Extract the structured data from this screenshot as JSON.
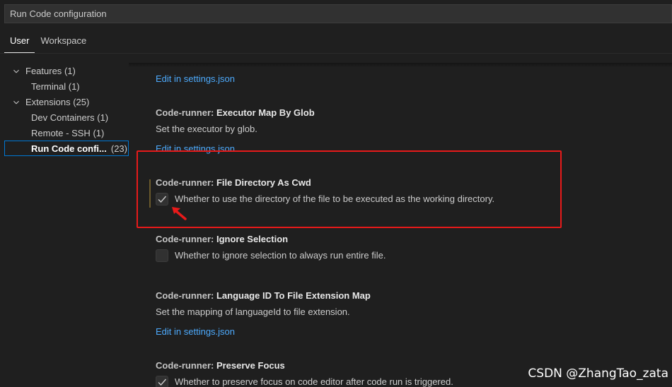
{
  "search": {
    "value": "Run Code configuration"
  },
  "tabs": [
    {
      "label": "User",
      "active": true
    },
    {
      "label": "Workspace",
      "active": false
    }
  ],
  "tree": [
    {
      "label": "Features",
      "count": "(1)"
    },
    {
      "label": "Terminal",
      "count": "(1)"
    },
    {
      "label": "Extensions",
      "count": "(25)"
    },
    {
      "label": "Dev Containers",
      "count": "(1)"
    },
    {
      "label": "Remote - SSH",
      "count": "(1)"
    },
    {
      "label": "Run Code confi...",
      "count": "(23)"
    }
  ],
  "settings": {
    "top_link": "Edit in settings.json",
    "executor_glob": {
      "category": "Code-runner: ",
      "name": "Executor Map By Glob",
      "description": "Set the executor by glob.",
      "link": "Edit in settings.json"
    },
    "file_dir_cwd": {
      "category": "Code-runner: ",
      "name": "File Directory As Cwd",
      "description": "Whether to use the directory of the file to be executed as the working directory.",
      "checked": true
    },
    "ignore_selection": {
      "category": "Code-runner: ",
      "name": "Ignore Selection",
      "description": "Whether to ignore selection to always run entire file.",
      "checked": false
    },
    "lang_id_map": {
      "category": "Code-runner: ",
      "name": "Language ID To File Extension Map",
      "description": "Set the mapping of languageId to file extension.",
      "link": "Edit in settings.json"
    },
    "preserve_focus": {
      "category": "Code-runner: ",
      "name": "Preserve Focus",
      "description": "Whether to preserve focus on code editor after code run is triggered.",
      "checked": true
    }
  },
  "watermark": "CSDN @ZhangTao_zata",
  "colors": {
    "accent": "#0078d4",
    "link": "#4daafc",
    "annotation": "#e81a1a"
  }
}
